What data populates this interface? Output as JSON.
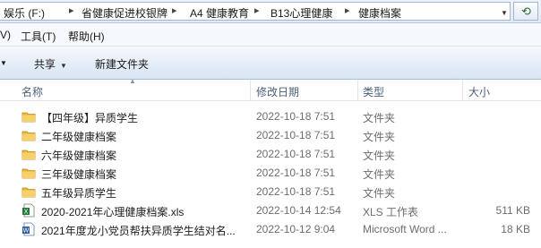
{
  "address_bar": {
    "crumbs": [
      "娱乐 (F:)",
      "省健康促进校银牌",
      "A4 健康教育",
      "B13心理健康",
      "健康档案"
    ]
  },
  "menu": {
    "items": [
      "V)",
      "工具(T)",
      "帮助(H)"
    ]
  },
  "toolbar": {
    "share_label": "共享",
    "new_folder_label": "新建文件夹"
  },
  "columns": {
    "name": "名称",
    "modified": "修改日期",
    "type": "类型",
    "size": "大小"
  },
  "files": [
    {
      "name": "【四年级】异质学生",
      "modified": "2022-10-18 7:51",
      "type": "文件夹",
      "size": "",
      "icon": "folder-icon"
    },
    {
      "name": "二年级健康档案",
      "modified": "2022-10-18 7:51",
      "type": "文件夹",
      "size": "",
      "icon": "folder-icon"
    },
    {
      "name": "六年级健康档案",
      "modified": "2022-10-18 7:51",
      "type": "文件夹",
      "size": "",
      "icon": "folder-icon"
    },
    {
      "name": "三年级健康档案",
      "modified": "2022-10-18 7:51",
      "type": "文件夹",
      "size": "",
      "icon": "folder-icon"
    },
    {
      "name": "五年级异质学生",
      "modified": "2022-10-18 7:51",
      "type": "文件夹",
      "size": "",
      "icon": "folder-icon"
    },
    {
      "name": "2020-2021年心理健康档案.xls",
      "modified": "2022-10-14 12:54",
      "type": "XLS 工作表",
      "size": "511 KB",
      "icon": "excel-file-icon"
    },
    {
      "name": "2021年度龙小党员帮扶异质学生结对名...",
      "modified": "2022-10-12 9:04",
      "type": "Microsoft Word ...",
      "size": "18 KB",
      "icon": "word-file-icon"
    }
  ],
  "colors": {
    "folder": "#e8b73a",
    "toolbar_bg": "#dfe9f5",
    "header_text": "#4c607a",
    "meta_text": "#6d6d6d"
  }
}
